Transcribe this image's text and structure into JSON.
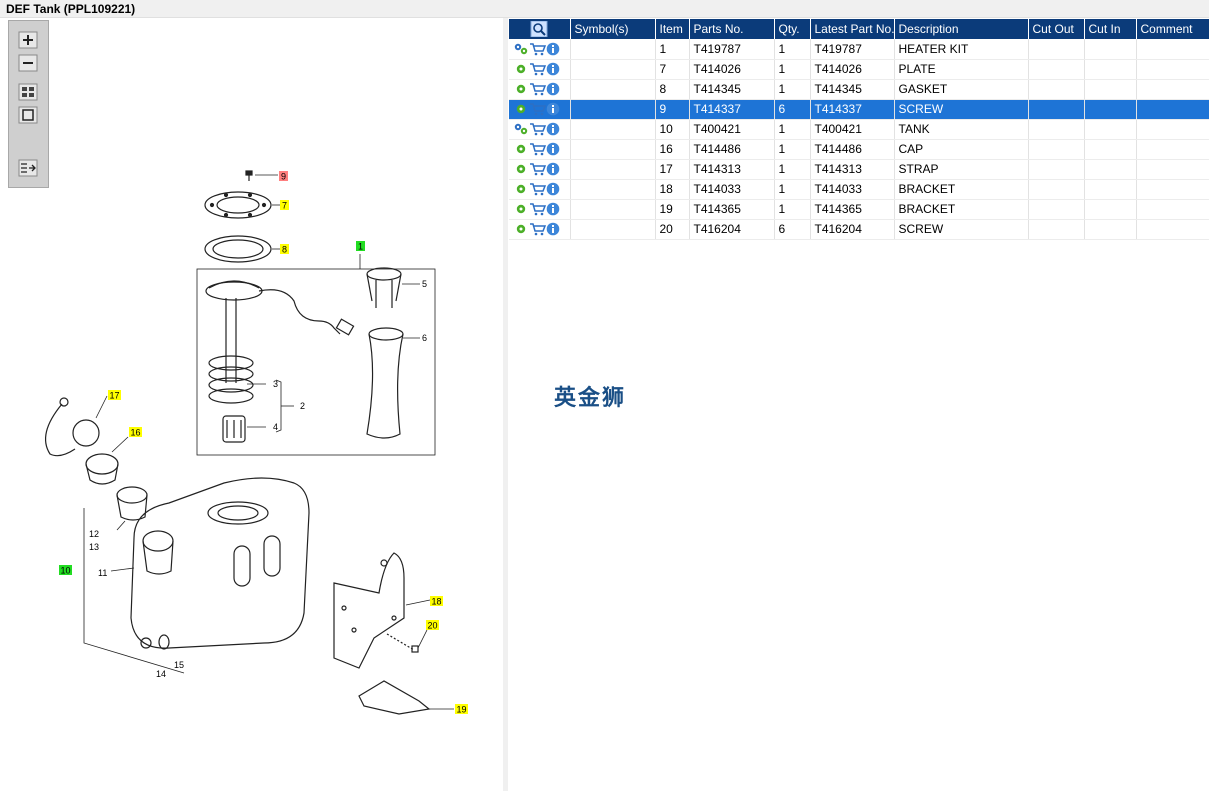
{
  "window": {
    "title": "DEF Tank (PPL109221)"
  },
  "colors": {
    "header_bg": "#0b3b7a",
    "selected_row": "#1e74d6",
    "callout_yellow": "#ffff00",
    "callout_green": "#22dd22",
    "callout_red": "#ff7f7f"
  },
  "zoom_toolbar": {
    "icons": [
      "zoom-in-icon",
      "zoom-out-icon",
      "fit-all-icon",
      "fit-window-icon",
      "list-icon"
    ]
  },
  "table": {
    "columns": [
      "Symbol(s)",
      "Item",
      "Parts No.",
      "Qty.",
      "Latest Part No.",
      "Description",
      "Cut Out",
      "Cut In",
      "Comment"
    ],
    "rows": [
      {
        "item": "1",
        "part": "T419787",
        "qty": "1",
        "latest": "T419787",
        "desc": "HEATER KIT",
        "selected": false,
        "multi": true
      },
      {
        "item": "7",
        "part": "T414026",
        "qty": "1",
        "latest": "T414026",
        "desc": "PLATE",
        "selected": false,
        "multi": false
      },
      {
        "item": "8",
        "part": "T414345",
        "qty": "1",
        "latest": "T414345",
        "desc": "GASKET",
        "selected": false,
        "multi": false
      },
      {
        "item": "9",
        "part": "T414337",
        "qty": "6",
        "latest": "T414337",
        "desc": "SCREW",
        "selected": true,
        "multi": false
      },
      {
        "item": "10",
        "part": "T400421",
        "qty": "1",
        "latest": "T400421",
        "desc": "TANK",
        "selected": false,
        "multi": true
      },
      {
        "item": "16",
        "part": "T414486",
        "qty": "1",
        "latest": "T414486",
        "desc": "CAP",
        "selected": false,
        "multi": false
      },
      {
        "item": "17",
        "part": "T414313",
        "qty": "1",
        "latest": "T414313",
        "desc": "STRAP",
        "selected": false,
        "multi": false
      },
      {
        "item": "18",
        "part": "T414033",
        "qty": "1",
        "latest": "T414033",
        "desc": "BRACKET",
        "selected": false,
        "multi": false
      },
      {
        "item": "19",
        "part": "T414365",
        "qty": "1",
        "latest": "T414365",
        "desc": "BRACKET",
        "selected": false,
        "multi": false
      },
      {
        "item": "20",
        "part": "T416204",
        "qty": "6",
        "latest": "T416204",
        "desc": "SCREW",
        "selected": false,
        "multi": false
      }
    ]
  },
  "diagram": {
    "callouts": [
      {
        "label": "9",
        "color": "red"
      },
      {
        "label": "7",
        "color": "yellow"
      },
      {
        "label": "8",
        "color": "yellow"
      },
      {
        "label": "1",
        "color": "green"
      },
      {
        "label": "17",
        "color": "yellow"
      },
      {
        "label": "16",
        "color": "yellow"
      },
      {
        "label": "10",
        "color": "green"
      },
      {
        "label": "18",
        "color": "yellow"
      },
      {
        "label": "20",
        "color": "yellow"
      },
      {
        "label": "19",
        "color": "yellow"
      }
    ],
    "plain_labels": [
      "5",
      "6",
      "3",
      "2",
      "4",
      "12",
      "13",
      "11",
      "15",
      "14"
    ]
  },
  "watermark": "英金狮"
}
